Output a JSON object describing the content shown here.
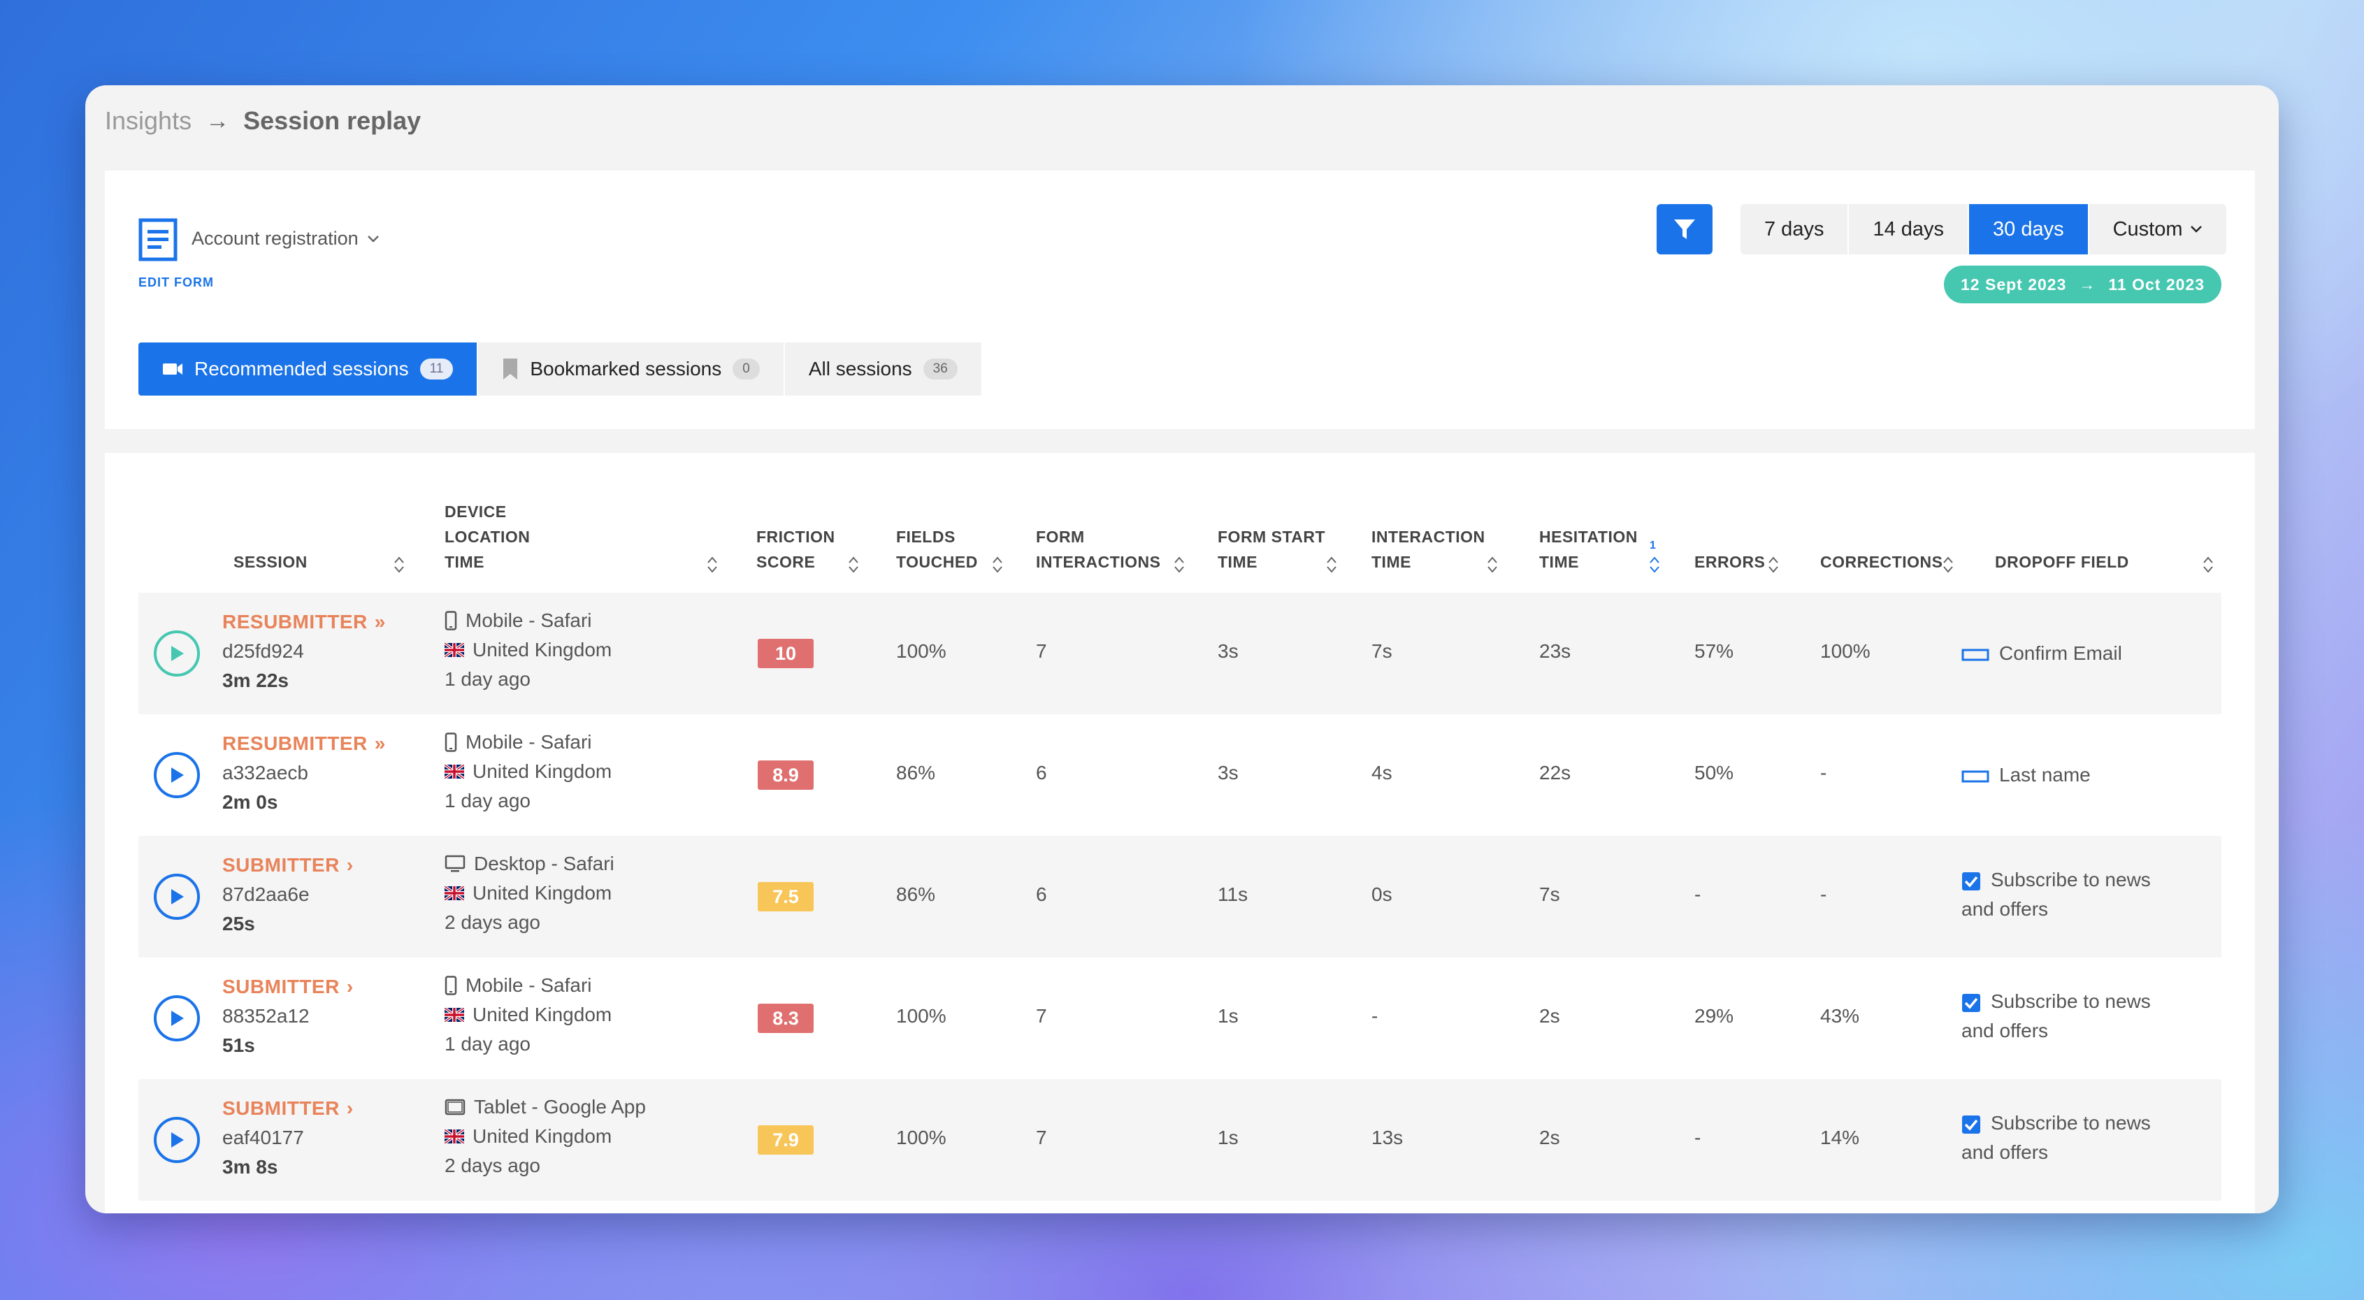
{
  "breadcrumb": {
    "parent": "Insights",
    "arrow": "→",
    "current": "Session replay"
  },
  "form": {
    "name": "Account registration",
    "edit_label": "EDIT FORM"
  },
  "date_ranges": [
    {
      "label": "7 days",
      "active": false
    },
    {
      "label": "14 days",
      "active": false
    },
    {
      "label": "30 days",
      "active": true
    },
    {
      "label": "Custom",
      "active": false
    }
  ],
  "date_pill": {
    "start": "12 Sept 2023",
    "end": "11 Oct 2023",
    "arrow": "→"
  },
  "tabs": [
    {
      "label": "Recommended sessions",
      "count": "11",
      "icon": "video-camera-icon",
      "active": true
    },
    {
      "label": "Bookmarked sessions",
      "count": "0",
      "icon": "bookmark-icon",
      "active": false
    },
    {
      "label": "All sessions",
      "count": "36",
      "active": false
    }
  ],
  "columns": [
    {
      "lines": [
        "SESSION"
      ]
    },
    {
      "lines": [
        "DEVICE",
        "LOCATION",
        "TIME"
      ]
    },
    {
      "lines": [
        "FRICTION",
        "SCORE"
      ]
    },
    {
      "lines": [
        "FIELDS",
        "TOUCHED"
      ]
    },
    {
      "lines": [
        "FORM",
        "INTERACTIONS"
      ]
    },
    {
      "lines": [
        "FORM START",
        "TIME"
      ]
    },
    {
      "lines": [
        "INTERACTION",
        "TIME"
      ]
    },
    {
      "lines": [
        "HESITATION",
        "TIME"
      ],
      "sort_order": "1"
    },
    {
      "lines": [
        "ERRORS"
      ]
    },
    {
      "lines": [
        "CORRECTIONS"
      ]
    },
    {
      "lines": [
        "DROPOFF FIELD"
      ]
    }
  ],
  "rows": [
    {
      "type": "RESUBMITTER",
      "type_chevron": "»",
      "id": "d25fd924",
      "duration": "3m 22s",
      "device": "Mobile - Safari",
      "device_icon": "mobile-phone-icon",
      "location": "United Kingdom",
      "time": "1 day ago",
      "friction": "10",
      "friction_level": "high",
      "fields_touched": "100%",
      "form_interactions": "7",
      "form_start_time": "3s",
      "interaction_time": "7s",
      "hesitation_time": "23s",
      "errors": "57%",
      "corrections": "100%",
      "dropoff_field": "Confirm Email",
      "dropoff_icon": "text-input-icon",
      "play_color": "#45c7b0"
    },
    {
      "type": "RESUBMITTER",
      "type_chevron": "»",
      "id": "a332aecb",
      "duration": "2m 0s",
      "device": "Mobile - Safari",
      "device_icon": "mobile-phone-icon",
      "location": "United Kingdom",
      "time": "1 day ago",
      "friction": "8.9",
      "friction_level": "high",
      "fields_touched": "86%",
      "form_interactions": "6",
      "form_start_time": "3s",
      "interaction_time": "4s",
      "hesitation_time": "22s",
      "errors": "50%",
      "corrections": "-",
      "dropoff_field": "Last name",
      "dropoff_icon": "text-input-icon",
      "play_color": "#1a73e8"
    },
    {
      "type": "SUBMITTER",
      "type_chevron": "›",
      "id": "87d2aa6e",
      "duration": "25s",
      "device": "Desktop - Safari",
      "device_icon": "desktop-icon",
      "location": "United Kingdom",
      "time": "2 days ago",
      "friction": "7.5",
      "friction_level": "medium",
      "fields_touched": "86%",
      "form_interactions": "6",
      "form_start_time": "11s",
      "interaction_time": "0s",
      "hesitation_time": "7s",
      "errors": "-",
      "corrections": "-",
      "dropoff_field": "Subscribe to news and offers",
      "dropoff_icon": "checkbox-icon",
      "play_color": "#1a73e8"
    },
    {
      "type": "SUBMITTER",
      "type_chevron": "›",
      "id": "88352a12",
      "duration": "51s",
      "device": "Mobile - Safari",
      "device_icon": "mobile-phone-icon",
      "location": "United Kingdom",
      "time": "1 day ago",
      "friction": "8.3",
      "friction_level": "high",
      "fields_touched": "100%",
      "form_interactions": "7",
      "form_start_time": "1s",
      "interaction_time": "-",
      "hesitation_time": "2s",
      "errors": "29%",
      "corrections": "43%",
      "dropoff_field": "Subscribe to news and offers",
      "dropoff_icon": "checkbox-icon",
      "play_color": "#1a73e8"
    },
    {
      "type": "SUBMITTER",
      "type_chevron": "›",
      "id": "eaf40177",
      "duration": "3m 8s",
      "device": "Tablet - Google App",
      "device_icon": "tablet-icon",
      "location": "United Kingdom",
      "time": "2 days ago",
      "friction": "7.9",
      "friction_level": "medium",
      "fields_touched": "100%",
      "form_interactions": "7",
      "form_start_time": "1s",
      "interaction_time": "13s",
      "hesitation_time": "2s",
      "errors": "-",
      "corrections": "14%",
      "dropoff_field": "Subscribe to news and offers",
      "dropoff_icon": "checkbox-icon",
      "play_color": "#1a73e8"
    }
  ],
  "colors": {
    "primary": "#1a73e8",
    "teal": "#45c7b0",
    "submitter_orange": "#e8835a",
    "friction_high": "#e07070",
    "friction_medium": "#f8c558"
  }
}
